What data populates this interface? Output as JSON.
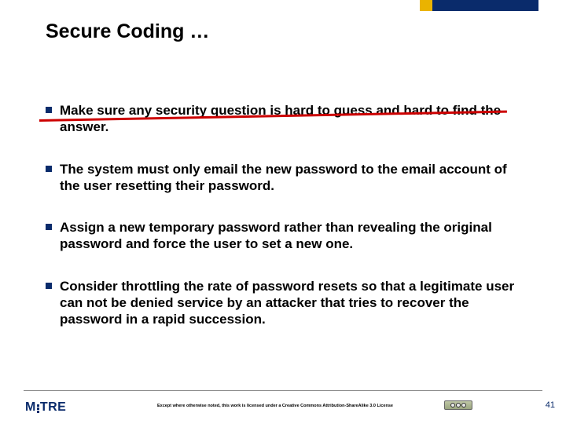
{
  "title": "Secure Coding …",
  "bullets": [
    "Make sure any security question is hard to guess and hard to find the answer.",
    "The system must only email the new password to the email account of the user resetting their password.",
    "Assign a new temporary password rather than revealing the original password and force the user to set a new one.",
    "Consider throttling the rate of password resets so that a legitimate user can not be denied service by an attacker that tries to recover the password in a rapid succession."
  ],
  "strike_bullet_index": 0,
  "footer": {
    "logo_text": "MITRE",
    "license_text": "Except where otherwise noted, this work is licensed under a Creative Commons Attribution-ShareAlike 3.0 License",
    "page_number": "41"
  },
  "colors": {
    "accent_yellow": "#eab300",
    "accent_navy": "#0a2b6b",
    "strike_red": "#cc0000"
  }
}
